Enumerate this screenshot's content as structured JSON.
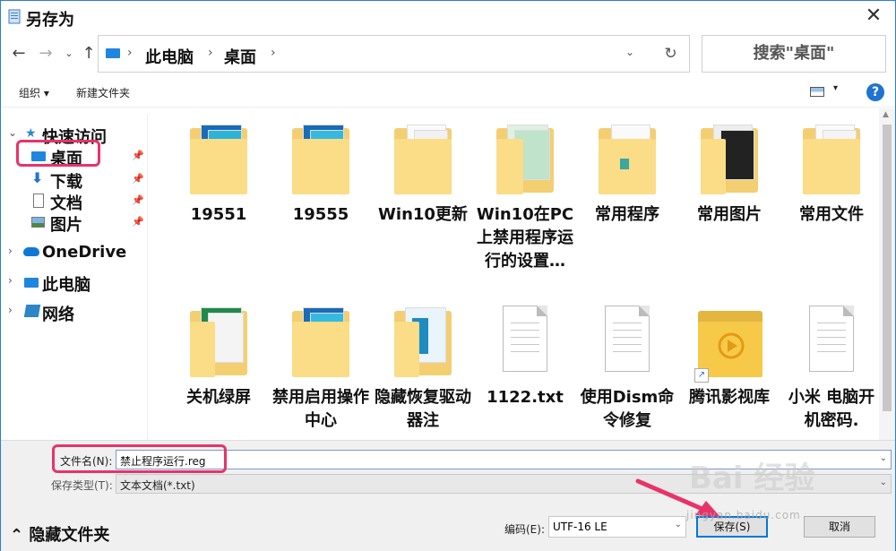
{
  "window": {
    "title": "另存为"
  },
  "address": {
    "breadcrumbs": [
      "此电脑",
      "桌面"
    ],
    "search_placeholder": "搜索\"桌面\""
  },
  "toolbar": {
    "organize": "组织 ▾",
    "new_folder": "新建文件夹",
    "help": "?"
  },
  "nav": {
    "quick_access": "快速访问",
    "desktop": "桌面",
    "downloads": "下载",
    "documents": "文档",
    "pictures": "图片",
    "onedrive": "OneDrive",
    "this_pc": "此电脑",
    "network": "网络"
  },
  "files": [
    {
      "name": "19551",
      "type": "folder"
    },
    {
      "name": "19555",
      "type": "folder"
    },
    {
      "name": "Win10更新",
      "type": "folder"
    },
    {
      "name": "Win10在PC上禁用程序运行的设置…",
      "type": "folder"
    },
    {
      "name": "常用程序",
      "type": "folder"
    },
    {
      "name": "常用图片",
      "type": "folder"
    },
    {
      "name": "常用文件",
      "type": "folder"
    },
    {
      "name": "关机绿屏",
      "type": "folder"
    },
    {
      "name": "禁用启用操作中心",
      "type": "folder"
    },
    {
      "name": "隐藏恢复驱动器注",
      "type": "folder"
    },
    {
      "name": "1122.txt",
      "type": "txt"
    },
    {
      "name": "使用Dism命令修复",
      "type": "txt"
    },
    {
      "name": "腾讯影视库",
      "type": "shortcut"
    },
    {
      "name": "小米 电脑开机密码.",
      "type": "txt"
    }
  ],
  "bottom": {
    "filename_label": "文件名(N):",
    "filename_value": "禁止程序运行.reg",
    "filetype_label": "保存类型(T):",
    "filetype_value": "文本文档(*.txt)",
    "hide_folders": "隐藏文件夹",
    "encoding_label": "编码(E):",
    "encoding_value": "UTF-16 LE",
    "save_button": "保存(S)",
    "cancel_button": "取消"
  },
  "watermark": {
    "main": "Bai 经验",
    "sub": "jingyan.baidu.com"
  },
  "colors": {
    "accent": "#0078d7",
    "highlight": "#e8336a",
    "folder": "#fbdc87"
  }
}
